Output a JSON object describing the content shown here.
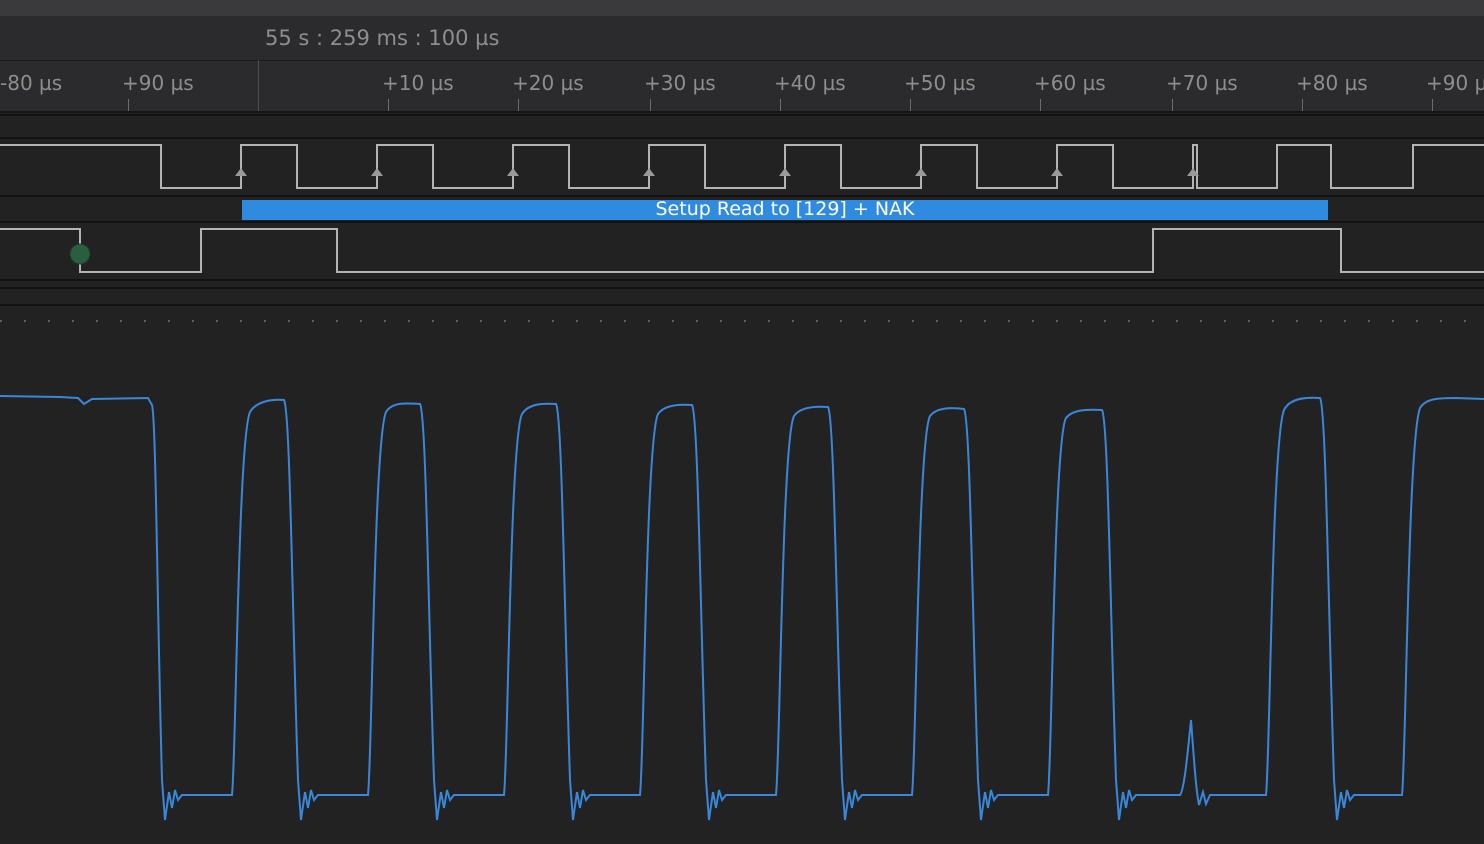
{
  "header": {
    "absolute_time": "55 s : 259 ms : 100 µs"
  },
  "ruler": {
    "ticks": [
      "-80 µs",
      "+90 µs",
      "+10 µs",
      "+20 µs",
      "+30 µs",
      "+40 µs",
      "+50 µs",
      "+60 µs",
      "+70 µs",
      "+80 µs",
      "+90 µs"
    ]
  },
  "analyzer": {
    "frame_label": "Setup Read to [129] + NAK",
    "frame_color": "#2f8be0"
  },
  "colors": {
    "background": "#222223",
    "digital_trace": "#b4b4b4",
    "analog_trace": "#3a86d8",
    "marker": "#2b5e3e"
  }
}
